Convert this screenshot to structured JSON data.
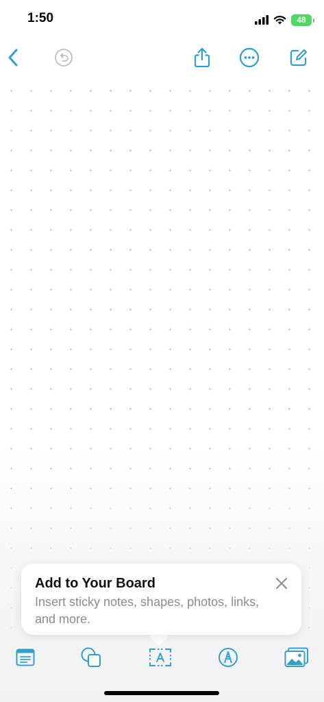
{
  "status": {
    "time": "1:50",
    "battery": "48"
  },
  "colors": {
    "accent": "#2f9fd1",
    "muted": "#b8b8b8"
  },
  "toolbar_top": {
    "icons": [
      "back-chevron-icon",
      "undo-icon",
      "share-icon",
      "more-icon",
      "compose-icon"
    ]
  },
  "tip": {
    "title": "Add to Your Board",
    "body": "Insert sticky notes, shapes, photos, links, and more."
  },
  "toolbar_bottom": {
    "icons": [
      "sticky-note-icon",
      "shapes-icon",
      "text-box-icon",
      "pen-icon",
      "photo-icon"
    ]
  }
}
